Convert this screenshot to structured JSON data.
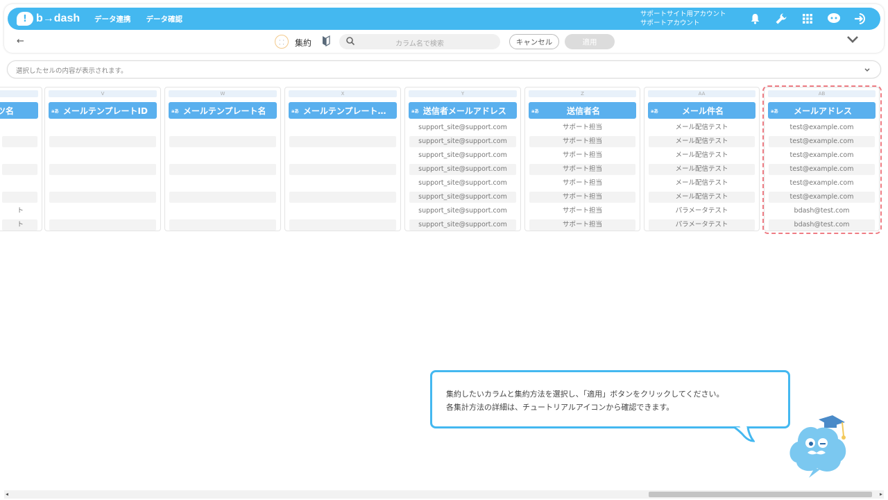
{
  "app": {
    "logo_mark": "!",
    "logo_text": "b→dash",
    "nav": [
      "データ連携",
      "データ確認"
    ],
    "account_line1": "サポートサイト用アカウント",
    "account_line2": "サポートアカウント",
    "icons": [
      "bell-icon",
      "wrench-icon",
      "grid-icon",
      "chat-icon",
      "logout-icon"
    ],
    "brand_color": "#44b8f0"
  },
  "toolbar": {
    "back": "←",
    "aggregate_label": "集約",
    "search_placeholder": "カラム名で検索",
    "cancel_label": "キャンセル",
    "apply_label": "適用",
    "collapse": "⌄"
  },
  "cellbar": {
    "placeholder": "選択したセルの内容が表示されます。"
  },
  "grid": {
    "type_badge": "aあ",
    "columns": [
      {
        "letter": "",
        "header": "ツ名",
        "cells": [
          "",
          "",
          "",
          "",
          "",
          "",
          "ト",
          "ト"
        ]
      },
      {
        "letter": "V",
        "header": "メールテンプレートID",
        "cells": [
          "",
          "",
          "",
          "",
          "",
          "",
          "",
          ""
        ]
      },
      {
        "letter": "W",
        "header": "メールテンプレート名",
        "cells": [
          "",
          "",
          "",
          "",
          "",
          "",
          "",
          ""
        ]
      },
      {
        "letter": "X",
        "header": "メールテンプレート…",
        "cells": [
          "",
          "",
          "",
          "",
          "",
          "",
          "",
          ""
        ]
      },
      {
        "letter": "Y",
        "header": "送信者メールアドレス",
        "cells": [
          "support_site@support.com",
          "support_site@support.com",
          "support_site@support.com",
          "support_site@support.com",
          "support_site@support.com",
          "support_site@support.com",
          "support_site@support.com",
          "support_site@support.com"
        ]
      },
      {
        "letter": "Z",
        "header": "送信者名",
        "cells": [
          "サポート担当",
          "サポート担当",
          "サポート担当",
          "サポート担当",
          "サポート担当",
          "サポート担当",
          "サポート担当",
          "サポート担当"
        ]
      },
      {
        "letter": "AA",
        "header": "メール件名",
        "cells": [
          "メール配信テスト",
          "メール配信テスト",
          "メール配信テスト",
          "メール配信テスト",
          "メール配信テスト",
          "メール配信テスト",
          "パラメータテスト",
          "パラメータテスト"
        ]
      },
      {
        "letter": "AB",
        "header": "メールアドレス",
        "cells": [
          "test@example.com",
          "test@example.com",
          "test@example.com",
          "test@example.com",
          "test@example.com",
          "test@example.com",
          "bdash@test.com",
          "bdash@test.com"
        ]
      }
    ]
  },
  "tooltip": {
    "line1": "集約したいカラムと集約方法を選択し、「適用」ボタンをクリックしてください。",
    "line2": "各集計方法の詳細は、チュートリアルアイコンから確認できます。"
  },
  "scrollbar": {
    "left_arrow": "◂",
    "right_arrow": "▸"
  }
}
